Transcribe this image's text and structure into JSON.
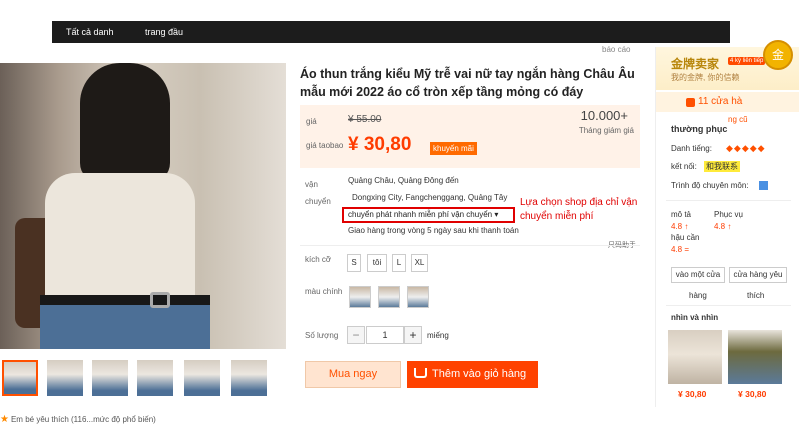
{
  "topnav": {
    "all_categories": "Tất cả danh",
    "home": "trang đầu"
  },
  "report": "báo cáo",
  "product": {
    "title": "Áo thun trắng kiểu Mỹ trễ vai nữ tay ngắn hàng Châu Âu mẫu mới 2022 áo cổ tròn xếp tầng mỏng có đáy",
    "price_label": "giá",
    "old_price": "¥ 55.00",
    "sold_count": "10.000+",
    "sold_label": "Tháng giám giá",
    "taobao_price_label": "giá taobao",
    "new_price": "¥ 30,80",
    "promo_badge": "khuyến mãi"
  },
  "shipping": {
    "label": "vận chuyển",
    "from": "Quảng Châu, Quảng Đông đến",
    "to": "Dongxing City, Fangchenggang, Quảng Tây",
    "method": "chuyển phát nhanh miễn phí vận chuyển",
    "delivery": "Giao hàng trong vòng 5 ngày sau khi thanh toán",
    "annotation": "Lựa chọn shop địa chỉ vận chuyển miễn phí",
    "size_guide": "尺码助手"
  },
  "sizes": {
    "label": "kích cỡ",
    "options": [
      "S",
      "tôi",
      "L",
      "XL"
    ]
  },
  "colors": {
    "label": "màu chính"
  },
  "quantity": {
    "label": "Số lượng",
    "value": "1",
    "unit": "miếng",
    "minus": "−",
    "plus": "+"
  },
  "actions": {
    "buy_now": "Mua ngay",
    "add_to_cart": "Thêm vào giỏ hàng"
  },
  "favorite": "Em bé yêu thích (116...mức độ phổ biến)",
  "shop": {
    "gold_title": "金牌卖家",
    "gold_badge": "4 kỳ liên tiếp",
    "gold_sub": "我的金牌, 你的信赖",
    "gold_seal": "金",
    "stores": "11 cửa hà",
    "old_tag": "ng cũ",
    "name": "thường phục",
    "reputation_label": "Danh tiếng:",
    "diamonds": "◆◆◆◆◆",
    "contact_label": "kết nối:",
    "contact_tag": "和我联系",
    "cert_label": "Trình độ chuyên môn:",
    "ratings": [
      {
        "label": "mô tả",
        "value": "4.8 ↑"
      },
      {
        "label": "Phục vụ",
        "value": "4.8 ↑"
      },
      {
        "label": "hậu cần",
        "value": "4.8 ="
      }
    ],
    "btn_enter": "vào một cửa",
    "btn_enter_sub": "hàng",
    "btn_collect": "cửa hàng yêu",
    "btn_collect_sub": "thích",
    "recommend_title": "nhìn và nhìn",
    "recommend_prices": [
      "¥ 30,80",
      "¥ 30,80"
    ]
  },
  "colors_theme": {
    "accent": "#ff5000",
    "price": "#ff3c00",
    "annotation": "#e00000"
  }
}
